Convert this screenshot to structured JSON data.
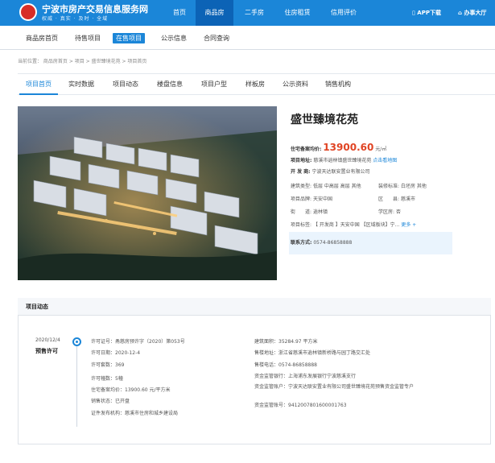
{
  "header": {
    "site_title": "宁波市房产交易信息服务网",
    "slogan": "权威 · 真实 · 及时 · 全域",
    "nav": [
      "首页",
      "商品房",
      "二手房",
      "住房租赁",
      "信用评价"
    ],
    "app_download": "APP下载",
    "mobile": "办事大厅"
  },
  "subnav": [
    "商品房首页",
    "待售项目",
    "在售项目",
    "公示信息",
    "合同查询"
  ],
  "breadcrumb": "当前位置： 商品房首页 > 项目 > 盛世臻境花苑 > 项目首页",
  "tabs": [
    "项目首页",
    "实时数据",
    "项目动态",
    "楼盘信息",
    "项目户型",
    "样板房",
    "公示资料",
    "销售机构"
  ],
  "project": {
    "name": "盛世臻境花苑",
    "price_label": "住宅备案均价:",
    "price": "13900.60",
    "price_unit": "元/㎡",
    "address_label": "项目地址:",
    "address": "慈溪市逍林镇盛世臻境花苑",
    "map_link": "点击看地图",
    "developer_label": "开 发 商:",
    "developer": "宁波天达联安置业有限公司",
    "building_type_label": "建筑类型:",
    "building_type": "低层 中高层 高层 其他",
    "decoration_label": "装修标准:",
    "decoration": "白坯房 其他",
    "brand_label": "项目品牌:",
    "brand": "天安中国",
    "district_label": "区　　县:",
    "district": "慈溪市",
    "street_label": "街　　道:",
    "street": "逍林镇",
    "school_label": "学区房:",
    "school": "否",
    "tags_label": "项目标签:",
    "tags": "【 开发商 】天安中国 【区域板块】宁...",
    "more": "更多 +",
    "contact_label": "联系方式:",
    "contact": "0574-86858888"
  },
  "dynamics": {
    "title": "项目动态",
    "date": "2020/12/4",
    "type": "预售许可",
    "left": [
      "许可证号：甬慈房预许字（2020）第053号",
      "许可日期：2020-12-4",
      "许可套数：369",
      "许可幢数：5幢",
      "住宅备案均价：13900.60 元/平方米",
      "销售状态：已开盘",
      "证件发布机构：慈溪市住房和城乡建设局"
    ],
    "right": [
      "建筑面积：35284.97 平方米",
      "售楼地址：浙江省慈溪市逍林镇新桥路与园丁路交汇处",
      "售楼电话：0574-86858888",
      "资金监管银行：上海浦东发展银行宁波慈溪支行",
      "资金监管账户：宁波天达联安置业有限公司盛世臻境花苑预售资金监管专户",
      "资金监管账号：941200780160000176​3"
    ]
  },
  "colors": {
    "primary": "#1b86d8",
    "price": "#e04424"
  }
}
